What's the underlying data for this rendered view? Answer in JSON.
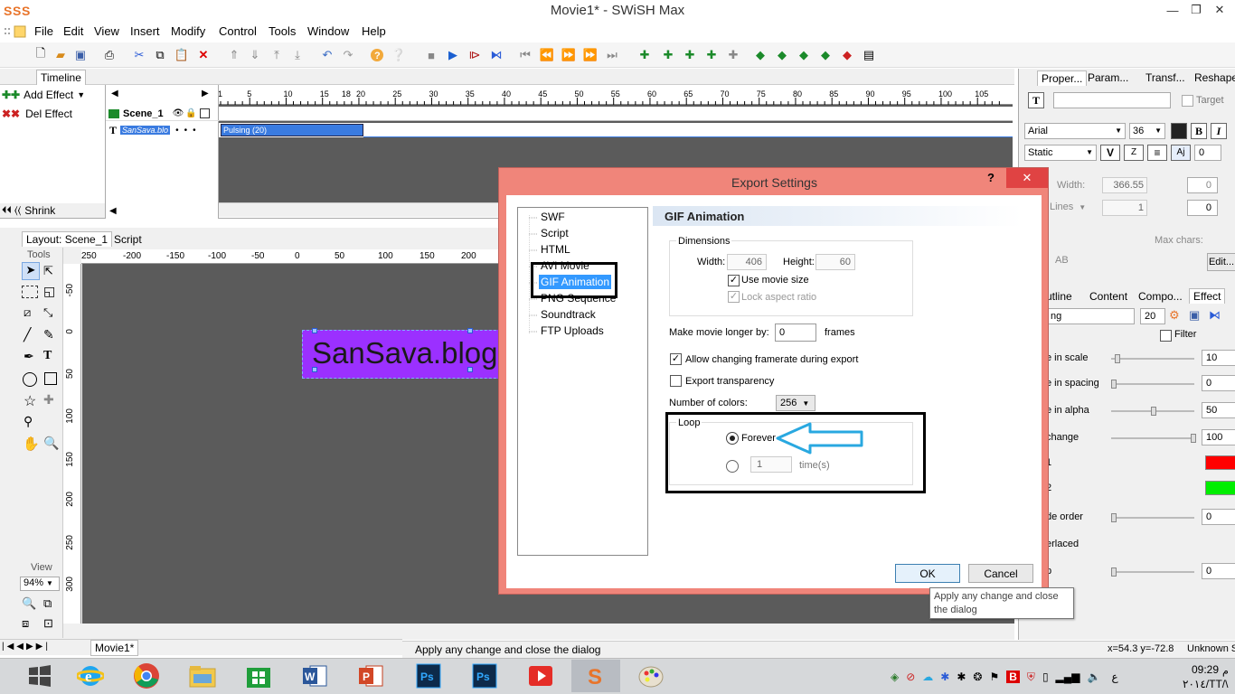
{
  "window": {
    "title": "Movie1* - SWiSH Max"
  },
  "menu": [
    "File",
    "Edit",
    "View",
    "Insert",
    "Modify",
    "Control",
    "Tools",
    "Window",
    "Help"
  ],
  "timeline": {
    "tab": "Timeline",
    "add_effect": "Add Effect",
    "del_effect": "Del Effect",
    "shrink": "Shrink",
    "scene": "Scene_1",
    "object": "SanSava.blo",
    "effect_bar": "Pulsing (20)",
    "frames": [
      "1",
      "5",
      "10",
      "15",
      "18",
      "20",
      "25",
      "30",
      "35",
      "40",
      "45",
      "50",
      "55",
      "60",
      "65",
      "70",
      "75",
      "80",
      "85",
      "90",
      "95",
      "100",
      "105"
    ]
  },
  "layout": {
    "tab": "Layout: Scene_1",
    "script_tab": "Script",
    "tools_label": "Tools",
    "view_label": "View",
    "zoom": "94%",
    "canvas_text": "SanSava.blog",
    "hruler": [
      "250",
      "-200",
      "-150",
      "-100",
      "-50",
      "0",
      "50",
      "100",
      "150",
      "200"
    ],
    "vruler": [
      "-50",
      "0",
      "50",
      "100",
      "150",
      "200",
      "250",
      "300"
    ],
    "movie_tab": "Movie1*"
  },
  "status": {
    "message": "Apply any change and close the dialog",
    "coords": "x=54.3 y=-72.8",
    "unknown": "Unknown S"
  },
  "right_panel": {
    "tabs": [
      "Proper...",
      "Param...",
      "Transf...",
      "Reshape"
    ],
    "target_label": "Target",
    "font": "Arial",
    "font_size": "36",
    "text_type": "Static",
    "width_label": "Width:",
    "width_value": "366.55",
    "lines_label": "Lines",
    "lines_value": "1",
    "zero1": "0",
    "zero2": "0",
    "max_chars": "Max chars:",
    "edit_btn": "Edit...",
    "lower_tabs": [
      "utline",
      "Content",
      "Compo...",
      "Effect"
    ],
    "effect_name": "ng",
    "effect_frames": "20",
    "filter_label": "Filter",
    "props": [
      {
        "label": "e in scale",
        "value": "10",
        "knob": 0.05
      },
      {
        "label": "e in spacing",
        "value": "0",
        "knob": 0.0
      },
      {
        "label": "e in alpha",
        "value": "50",
        "knob": 0.5
      },
      {
        "label": "change",
        "value": "100",
        "knob": 1.0
      },
      {
        "label": "1",
        "value": "",
        "color": "#ff0000"
      },
      {
        "label": "2",
        "value": "",
        "color": "#00ee00"
      },
      {
        "label": "de order",
        "value": "0",
        "knob": 0.0
      },
      {
        "label": "erlaced",
        "value": ""
      },
      {
        "label": "p",
        "value": "0",
        "knob": 0.0
      }
    ]
  },
  "dialog": {
    "title": "Export Settings",
    "help": "?",
    "close": "✕",
    "tree": [
      "SWF",
      "Script",
      "HTML",
      "AVI Movie",
      "GIF Animation",
      "PNG Sequence",
      "Soundtrack",
      "FTP Uploads"
    ],
    "selected": "GIF Animation",
    "section_title": "GIF Animation",
    "dimensions_label": "Dimensions",
    "width_label": "Width:",
    "width_value": "406",
    "height_label": "Height:",
    "height_value": "60",
    "use_movie_size": "Use movie size",
    "lock_aspect": "Lock aspect ratio",
    "longer_label": "Make movie longer by:",
    "longer_value": "0",
    "frames_label": "frames",
    "allow_framerate": "Allow changing framerate during export",
    "export_transparency": "Export transparency",
    "colors_label": "Number of colors:",
    "colors_value": "256",
    "loop_label": "Loop",
    "forever": "Forever",
    "times_value": "1",
    "times_label": "time(s)",
    "ok": "OK",
    "cancel": "Cancel",
    "tooltip": "Apply any change and close the dialog"
  },
  "taskbar": {
    "time": "09:29",
    "ampm": "م",
    "date": "٢٠١٤/TT/\\"
  },
  "colors": {
    "dialog_border": "#f0857a",
    "selection": "#3399ff",
    "annotation": "#29a8e0",
    "purple": "#9b30ff"
  }
}
